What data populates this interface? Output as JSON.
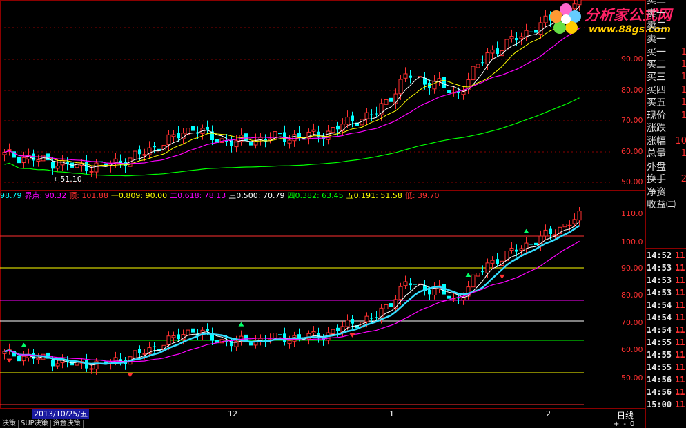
{
  "logo": {
    "site": "分析家公式网",
    "url": "www.88gs.com"
  },
  "top_price_axis": [
    "90.00",
    "80.00",
    "70.00",
    "60.00",
    "50.00"
  ],
  "bottom_price_axis": [
    "110.0",
    "100.0",
    "90.00",
    "80.00",
    "70.00",
    "60.00",
    "50.00"
  ],
  "low_marker": "←51.10",
  "fib_bar": [
    {
      "label": "98.79",
      "color": "#00ffff"
    },
    {
      "label": "界点: 90.32",
      "color": "#ff00ff"
    },
    {
      "label": "顶: 101.88",
      "color": "#ff3030"
    },
    {
      "label": "一0.809: 90.00",
      "color": "#ffff00"
    },
    {
      "label": "二0.618: 78.13",
      "color": "#ff00ff"
    },
    {
      "label": "三0.500: 70.79",
      "color": "#ffffff"
    },
    {
      "label": "四0.382: 63.45",
      "color": "#00ff00"
    },
    {
      "label": "五0.191: 51.58",
      "color": "#ffff00"
    },
    {
      "label": "低: 39.70",
      "color": "#ff3030"
    }
  ],
  "order_book": [
    {
      "label": "卖二",
      "value": ""
    },
    {
      "label": "卖一",
      "value": ""
    },
    {
      "label": "卖二",
      "value": ""
    },
    {
      "label": "卖一",
      "value": ""
    },
    {
      "label": "买一",
      "value": "1"
    },
    {
      "label": "买二",
      "value": "1"
    },
    {
      "label": "买三",
      "value": "1"
    },
    {
      "label": "买四",
      "value": "1"
    },
    {
      "label": "买五",
      "value": "1"
    },
    {
      "label": "现价",
      "value": "1"
    },
    {
      "label": "涨跌",
      "value": ""
    },
    {
      "label": "涨幅",
      "value": "10"
    },
    {
      "label": "总量",
      "value": "1"
    },
    {
      "label": "外盘",
      "value": ""
    },
    {
      "label": "换手",
      "value": "2"
    },
    {
      "label": "净资",
      "value": ""
    },
    {
      "label": "收益㈢",
      "value": ""
    }
  ],
  "ticks": [
    {
      "time": "14:52",
      "value": "11"
    },
    {
      "time": "14:53",
      "value": "11"
    },
    {
      "time": "14:53",
      "value": "11"
    },
    {
      "time": "14:53",
      "value": "11"
    },
    {
      "time": "14:54",
      "value": "11"
    },
    {
      "time": "14:54",
      "value": "11"
    },
    {
      "time": "14:54",
      "value": "11"
    },
    {
      "time": "14:55",
      "value": "11"
    },
    {
      "time": "14:55",
      "value": "11"
    },
    {
      "time": "14:55",
      "value": "11"
    },
    {
      "time": "14:56",
      "value": "11"
    },
    {
      "time": "14:56",
      "value": "11"
    },
    {
      "time": "15:00",
      "value": "11"
    }
  ],
  "date_axis": {
    "selected": "2013/10/25/五",
    "marks": [
      "12",
      "1",
      "2"
    ]
  },
  "period_label": "日线",
  "bottom_tabs": [
    "决策",
    "SUP决策",
    "资金决策"
  ],
  "zoom_buttons": [
    "+",
    "-",
    "0"
  ],
  "colors": {
    "up": "#ff3030",
    "down": "#00ffff",
    "ma5": "#ffffff",
    "ma10": "#ffff00",
    "ma20": "#ff00ff",
    "ma60": "#00ff00",
    "frame": "#8b0000"
  }
}
